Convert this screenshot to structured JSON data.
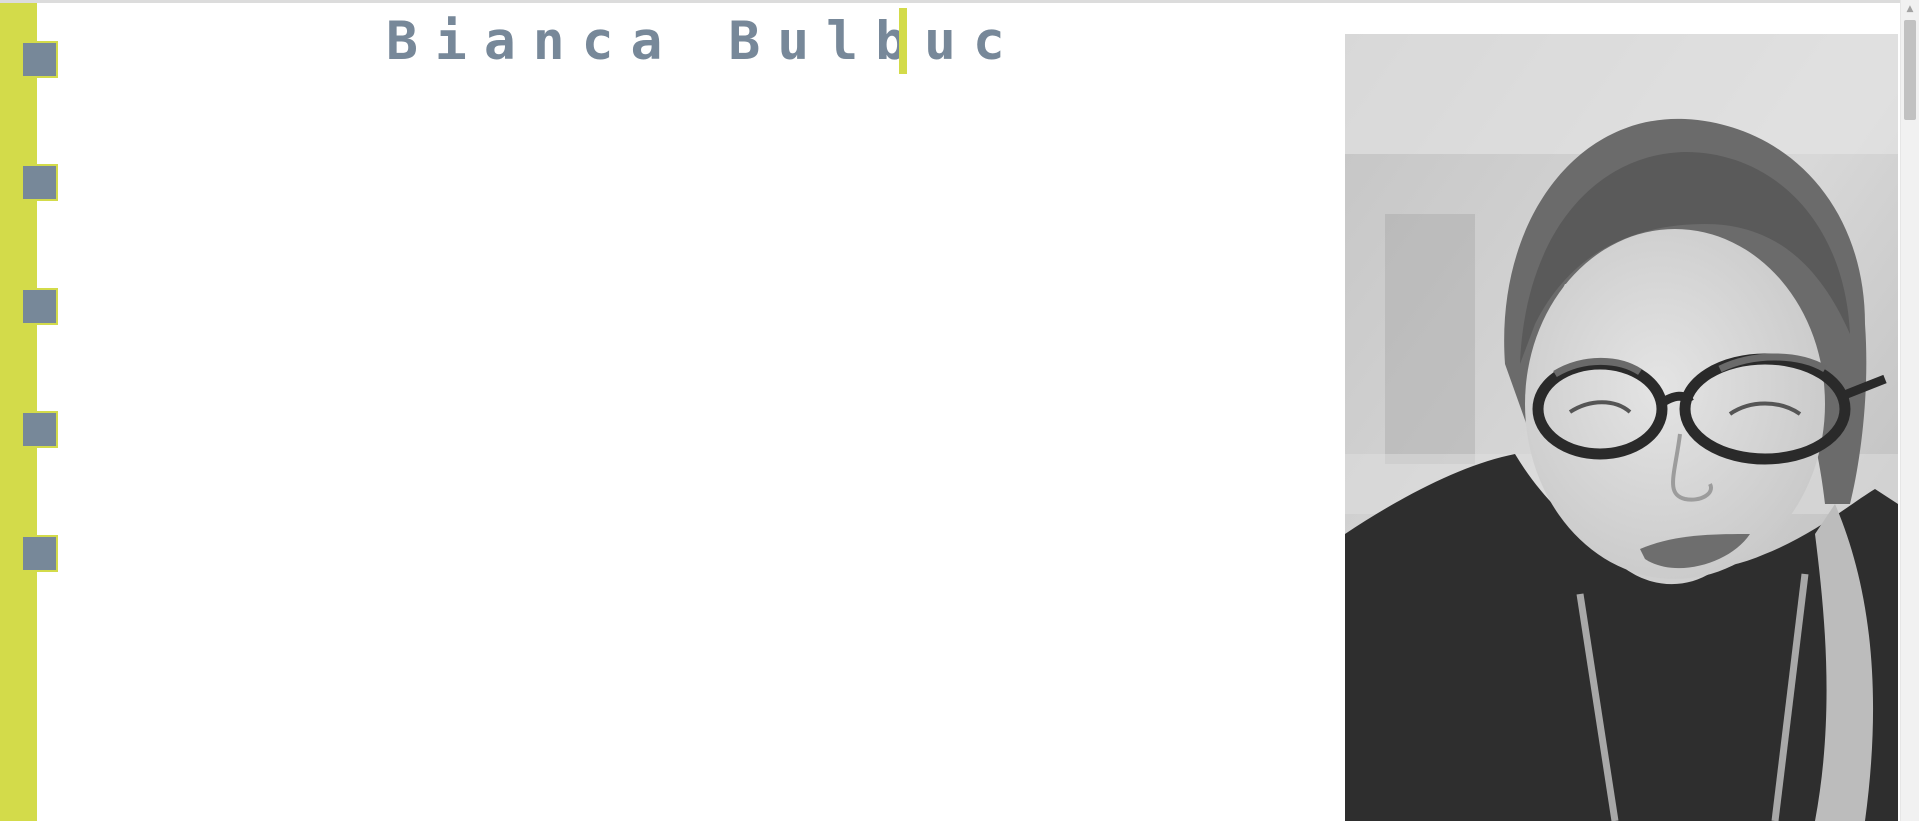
{
  "header": {
    "name": "Bianca Bulbuc"
  },
  "sidebar": {
    "items": [
      {
        "name": "nav-item-1"
      },
      {
        "name": "nav-item-2"
      },
      {
        "name": "nav-item-3"
      },
      {
        "name": "nav-item-4"
      },
      {
        "name": "nav-item-5"
      }
    ]
  },
  "icons": {
    "scroll_up": "chevron-up-icon"
  },
  "colors": {
    "accent": "#d3db4a",
    "slate": "#778899",
    "background": "#ffffff"
  }
}
